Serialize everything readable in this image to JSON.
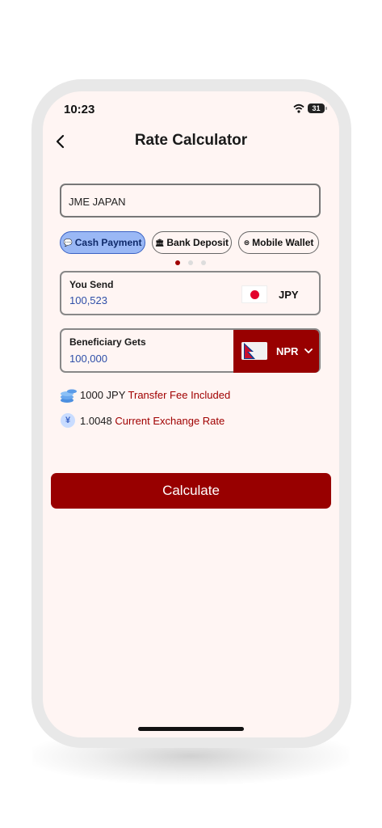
{
  "status_bar": {
    "time": "10:23",
    "battery": "31"
  },
  "header": {
    "title": "Rate Calculator"
  },
  "agent": {
    "value": "JME JAPAN"
  },
  "payment_methods": [
    {
      "label": "Cash Payment",
      "active": true
    },
    {
      "label": "Bank Deposit",
      "active": false
    },
    {
      "label": "Mobile Wallet",
      "active": false
    }
  ],
  "pager": {
    "current": 1,
    "total": 3
  },
  "send": {
    "label": "You Send",
    "amount": "100,523",
    "currency": "JPY"
  },
  "receive": {
    "label": "Beneficiary Gets",
    "amount": "100,000",
    "currency": "NPR"
  },
  "info": {
    "fee_value": "1000 JPY",
    "fee_desc": "Transfer Fee Included",
    "rate_value": "1.0048",
    "rate_desc": "Current Exchange Rate",
    "rate_icon_glyph": "¥"
  },
  "actions": {
    "calculate_label": "Calculate"
  },
  "colors": {
    "accent": "#980000",
    "chip_active": "#9ab8f5",
    "amount_blue": "#2f4fa8"
  }
}
